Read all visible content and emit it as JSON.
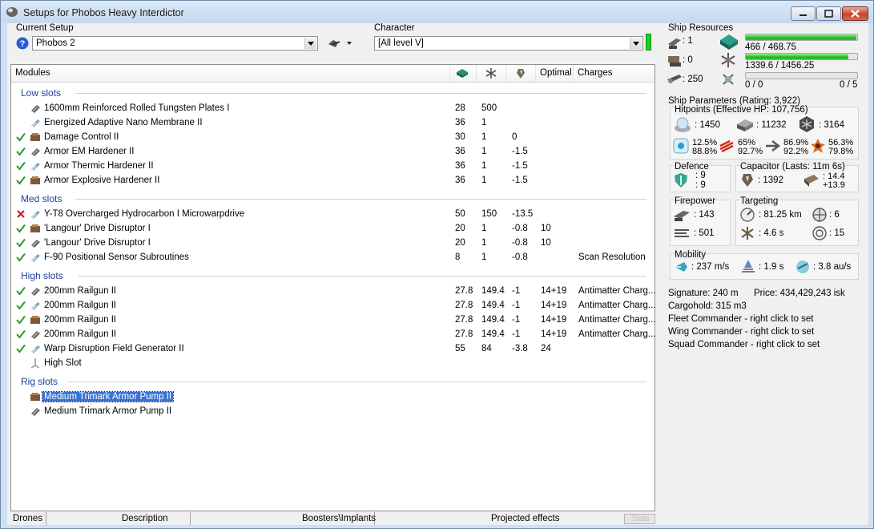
{
  "window": {
    "title": "Setups for Phobos Heavy Interdictor"
  },
  "setup": {
    "label": "Current Setup",
    "value": "Phobos 2"
  },
  "character": {
    "label": "Character",
    "value": "[All level V]"
  },
  "columns": {
    "modules": "Modules",
    "optimal": "Optimal",
    "charges": "Charges"
  },
  "groups": {
    "low": "Low slots",
    "med": "Med slots",
    "high": "High slots",
    "rig": "Rig slots"
  },
  "low": [
    {
      "name": "1600mm Reinforced Rolled Tungsten Plates I",
      "cpu": "28",
      "pg": "500",
      "cap": "",
      "optimal": "",
      "charges": ""
    },
    {
      "name": "Energized Adaptive Nano Membrane II",
      "cpu": "36",
      "pg": "1",
      "cap": "",
      "optimal": "",
      "charges": ""
    },
    {
      "name": "Damage Control II",
      "cpu": "30",
      "pg": "1",
      "cap": "0",
      "optimal": "",
      "charges": ""
    },
    {
      "name": "Armor EM Hardener II",
      "cpu": "36",
      "pg": "1",
      "cap": "-1.5",
      "optimal": "",
      "charges": ""
    },
    {
      "name": "Armor Thermic Hardener II",
      "cpu": "36",
      "pg": "1",
      "cap": "-1.5",
      "optimal": "",
      "charges": ""
    },
    {
      "name": "Armor Explosive Hardener II",
      "cpu": "36",
      "pg": "1",
      "cap": "-1.5",
      "optimal": "",
      "charges": ""
    }
  ],
  "med": [
    {
      "name": "Y-T8 Overcharged Hydrocarbon I Microwarpdrive",
      "cpu": "50",
      "pg": "150",
      "cap": "-13.5",
      "optimal": "",
      "charges": ""
    },
    {
      "name": "'Langour' Drive Disruptor I",
      "cpu": "20",
      "pg": "1",
      "cap": "-0.8",
      "optimal": "10",
      "charges": ""
    },
    {
      "name": "'Langour' Drive Disruptor I",
      "cpu": "20",
      "pg": "1",
      "cap": "-0.8",
      "optimal": "10",
      "charges": ""
    },
    {
      "name": "F-90 Positional Sensor Subroutines",
      "cpu": "8",
      "pg": "1",
      "cap": "-0.8",
      "optimal": "",
      "charges": "Scan Resolution"
    }
  ],
  "high": [
    {
      "name": "200mm Railgun II",
      "cpu": "27.8",
      "pg": "149.4",
      "cap": "-1",
      "optimal": "14+19",
      "charges": "Antimatter Charg..."
    },
    {
      "name": "200mm Railgun II",
      "cpu": "27.8",
      "pg": "149.4",
      "cap": "-1",
      "optimal": "14+19",
      "charges": "Antimatter Charg..."
    },
    {
      "name": "200mm Railgun II",
      "cpu": "27.8",
      "pg": "149.4",
      "cap": "-1",
      "optimal": "14+19",
      "charges": "Antimatter Charg..."
    },
    {
      "name": "200mm Railgun II",
      "cpu": "27.8",
      "pg": "149.4",
      "cap": "-1",
      "optimal": "14+19",
      "charges": "Antimatter Charg..."
    },
    {
      "name": "Warp Disruption Field Generator II",
      "cpu": "55",
      "pg": "84",
      "cap": "-3.8",
      "optimal": "24",
      "charges": ""
    },
    {
      "name": "High Slot",
      "cpu": "",
      "pg": "",
      "cap": "",
      "optimal": "",
      "charges": ""
    }
  ],
  "rig": [
    {
      "name": "Medium Trimark Armor Pump II"
    },
    {
      "name": "Medium Trimark Armor Pump II"
    }
  ],
  "tabs": {
    "drones": "Drones",
    "description": "Description",
    "boosters": "Boosters\\Implants",
    "projected": "Projected effects",
    "stats": "Stats"
  },
  "resources": {
    "title": "Ship Resources",
    "turrets": ": 1",
    "launchers": ": 0",
    "drone_bay": ": 250",
    "cpu": "466 / 468.75",
    "cpu_frac": 0.994,
    "power": "1339.6 / 1456.25",
    "power_frac": 0.92,
    "calib": "0 / 0",
    "drones": "0 / 5"
  },
  "params": {
    "title": "Ship Parameters (Rating: 3,922)",
    "hp_title": "Hitpoints (Effective HP: 107,756)",
    "shield_hp": ": 1450",
    "armor_hp": ": 11232",
    "hull_hp": ": 3164",
    "r1a": "12.5%",
    "r1b": "88.8%",
    "r2a": "65%",
    "r2b": "92.7%",
    "r3a": "86.9%",
    "r3b": "92.2%",
    "r4a": "56.3%",
    "r4b": "79.8%",
    "def_title": "Defence",
    "def_a": ": 9",
    "def_b": ": 9",
    "cap_title": "Capacitor (Lasts: 11m 6s)",
    "cap_amount": ": 1392",
    "cap_a": ": 14.4",
    "cap_b": "+13.9",
    "fire_title": "Firepower",
    "fire_a": ": 143",
    "fire_b": ": 501",
    "tgt_title": "Targeting",
    "tgt_range": ": 81.25 km",
    "tgt_count": ": 6",
    "tgt_lock": ": 4.6 s",
    "tgt_scan": ": 15",
    "mob_title": "Mobility",
    "speed": ": 237 m/s",
    "align": ": 1.9 s",
    "warp": ": 3.8 au/s",
    "signature": "Signature: 240 m",
    "price": "Price: 434,429,243 isk",
    "cargo": "Cargohold: 315 m3",
    "fleet": "Fleet Commander - right click to set",
    "wing": "Wing Commander - right click to set",
    "squad": "Squad Commander - right click to set"
  }
}
